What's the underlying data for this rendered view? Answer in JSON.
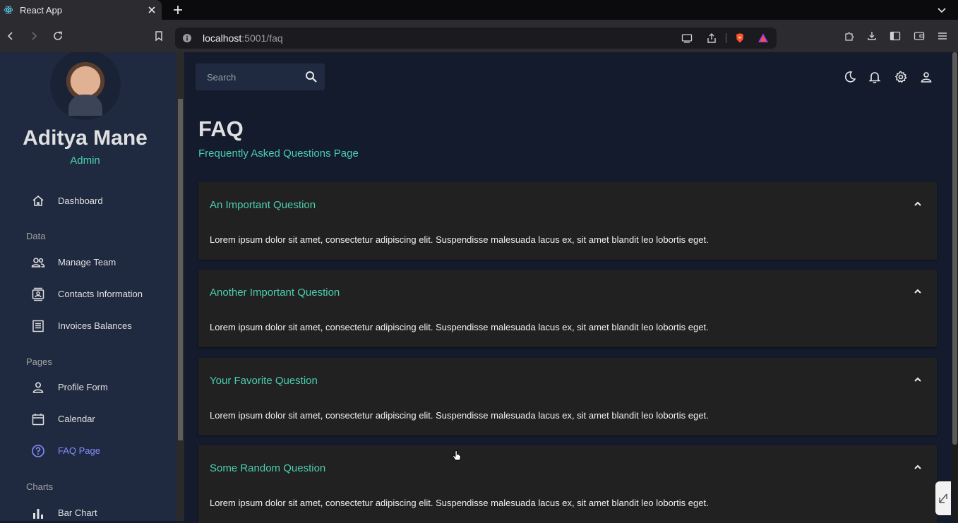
{
  "browser": {
    "tab_title": "React App",
    "url_host": "localhost",
    "url_path": ":5001/faq"
  },
  "sidebar": {
    "user_name": "Aditya Mane",
    "user_role": "Admin",
    "sections": {
      "data": "Data",
      "pages": "Pages",
      "charts": "Charts"
    },
    "items": [
      {
        "label": "Dashboard",
        "icon": "home-icon"
      },
      {
        "label": "Manage Team",
        "icon": "people-icon"
      },
      {
        "label": "Contacts Information",
        "icon": "contacts-icon"
      },
      {
        "label": "Invoices Balances",
        "icon": "receipt-icon"
      },
      {
        "label": "Profile Form",
        "icon": "person-icon"
      },
      {
        "label": "Calendar",
        "icon": "calendar-icon"
      },
      {
        "label": "FAQ Page",
        "icon": "help-icon",
        "active": true
      },
      {
        "label": "Bar Chart",
        "icon": "bar-chart-icon"
      }
    ]
  },
  "topbar": {
    "search_placeholder": "Search"
  },
  "header": {
    "title": "FAQ",
    "subtitle": "Frequently Asked Questions Page"
  },
  "faq": [
    {
      "question": "An Important Question",
      "answer": "Lorem ipsum dolor sit amet, consectetur adipiscing elit. Suspendisse malesuada lacus ex, sit amet blandit leo lobortis eget."
    },
    {
      "question": "Another Important Question",
      "answer": "Lorem ipsum dolor sit amet, consectetur adipiscing elit. Suspendisse malesuada lacus ex, sit amet blandit leo lobortis eget."
    },
    {
      "question": "Your Favorite Question",
      "answer": "Lorem ipsum dolor sit amet, consectetur adipiscing elit. Suspendisse malesuada lacus ex, sit amet blandit leo lobortis eget."
    },
    {
      "question": "Some Random Question",
      "answer": "Lorem ipsum dolor sit amet, consectetur adipiscing elit. Suspendisse malesuada lacus ex, sit amet blandit leo lobortis eget."
    }
  ],
  "colors": {
    "accent_green": "#4cceac",
    "active_nav": "#868dfb",
    "background": "#141b2d",
    "sidebar": "#1f2a40",
    "card": "#212121"
  }
}
